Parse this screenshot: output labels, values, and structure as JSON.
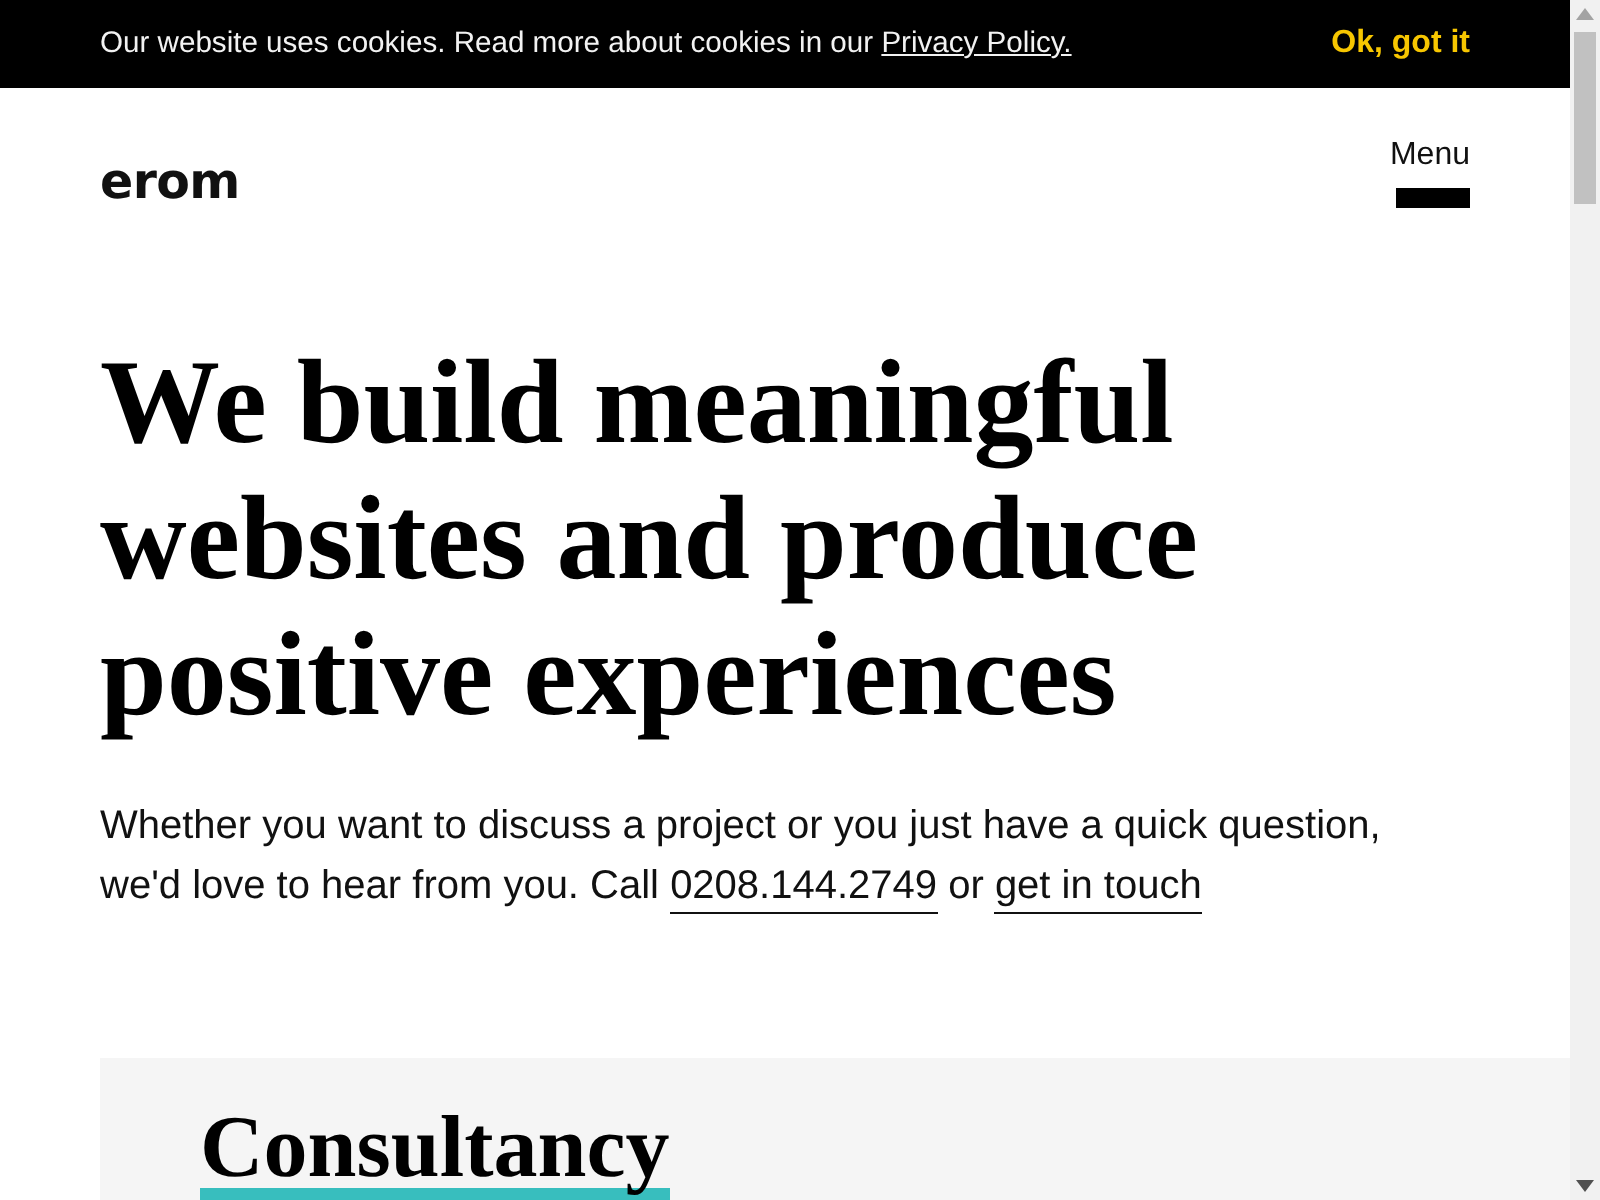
{
  "cookie_banner": {
    "message": "Our website uses cookies. Read more about cookies in our",
    "link": "Privacy Policy.",
    "button": "Ok, got it"
  },
  "header": {
    "logo": "erom",
    "menu": "Menu"
  },
  "hero": {
    "heading": "We build meaningful websites and produce positive experiences",
    "intro": {
      "text": "Whether you want to discuss a project or you just have a quick question, we'd love to hear from you. Call",
      "phone": "0208.144.2749",
      "joiner": "or",
      "link": "get in touch"
    }
  },
  "section": {
    "title": "Consultancy"
  }
}
